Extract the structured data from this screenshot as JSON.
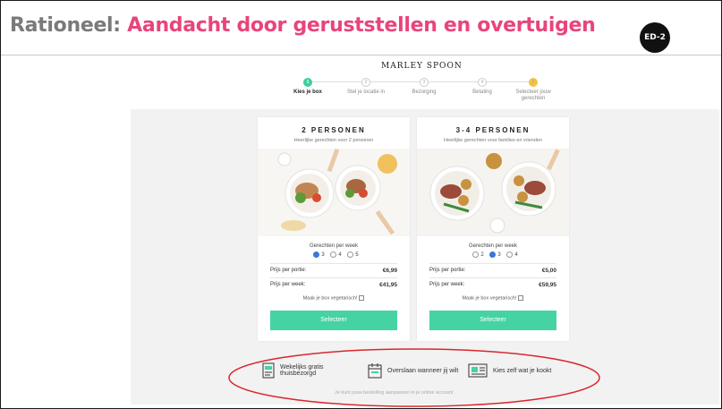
{
  "slide": {
    "title_prefix": "Rationeel:",
    "title_main": "Aandacht door geruststellen en overtuigen",
    "badge": "ED-2"
  },
  "site": {
    "logo": "MARLEY SPOON",
    "steps": [
      {
        "num": "1",
        "label": "Kies je box"
      },
      {
        "num": "2",
        "label": "Stel je locatie in"
      },
      {
        "num": "3",
        "label": "Bezorging"
      },
      {
        "num": "4",
        "label": "Betaling"
      },
      {
        "num": "5",
        "label": "Selecteer jouw gerechten"
      }
    ]
  },
  "cards": [
    {
      "title": "2 PERSONEN",
      "subtitle": "Heerlijke gerechten voor 2 personen",
      "freq_label": "Gerechten per week",
      "options": [
        "3",
        "4",
        "5"
      ],
      "selected": "3",
      "price_portion_label": "Prijs per portie:",
      "price_portion": "€6,99",
      "price_week_label": "Prijs per week:",
      "price_week": "€41,95",
      "veg_label": "Maak je box vegetarisch!",
      "button": "Selecteer"
    },
    {
      "title": "3-4 PERSONEN",
      "subtitle": "Heerlijke gerechten voor families en vrienden",
      "freq_label": "Gerechten per week",
      "options": [
        "2",
        "3",
        "4"
      ],
      "selected": "3",
      "price_portion_label": "Prijs per portie:",
      "price_portion": "€5,00",
      "price_week_label": "Prijs per week:",
      "price_week": "€59,95",
      "veg_label": "Maak je box vegetarisch!",
      "button": "Selecteer"
    }
  ],
  "benefits": {
    "b1_line1": "Wekelijks gratis",
    "b1_line2": "thuisbezorgd",
    "b2": "Overslaan wanneer jij wilt",
    "b3": "Kies zelf wat je kookt",
    "note": "Je kunt jouw bestelling aanpassen in je online account"
  },
  "colors": {
    "title_grey": "#7a7a7a",
    "title_pink": "#e8457a",
    "accent_green": "#45d3a3",
    "highlight_red": "#d9262c"
  }
}
